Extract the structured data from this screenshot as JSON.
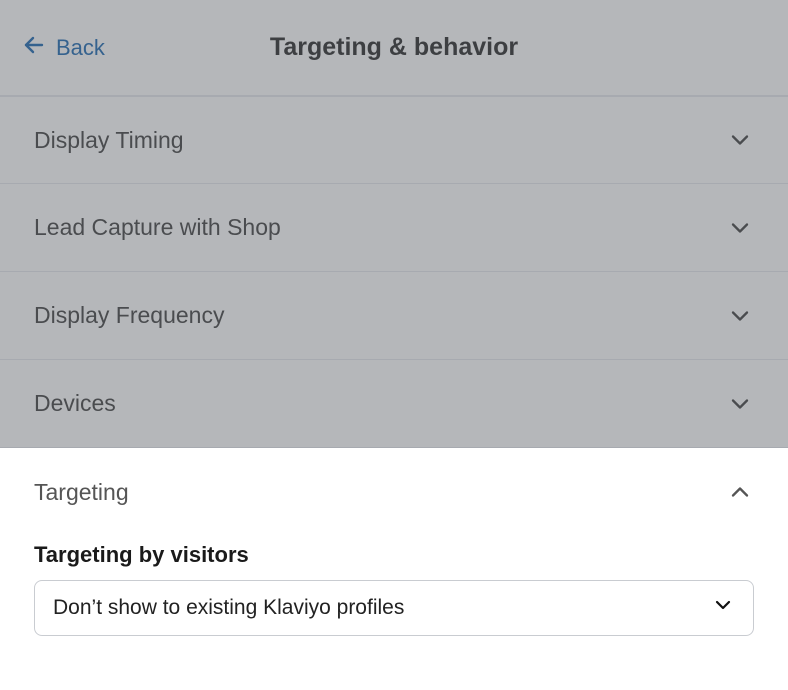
{
  "header": {
    "back_label": "Back",
    "title": "Targeting & behavior"
  },
  "accordion": {
    "display_timing": "Display Timing",
    "lead_capture": "Lead Capture with Shop",
    "display_frequency": "Display Frequency",
    "devices": "Devices",
    "targeting": "Targeting"
  },
  "targeting_section": {
    "sub_label": "Targeting by visitors",
    "selected_value": "Don’t show to existing Klaviyo profiles"
  }
}
